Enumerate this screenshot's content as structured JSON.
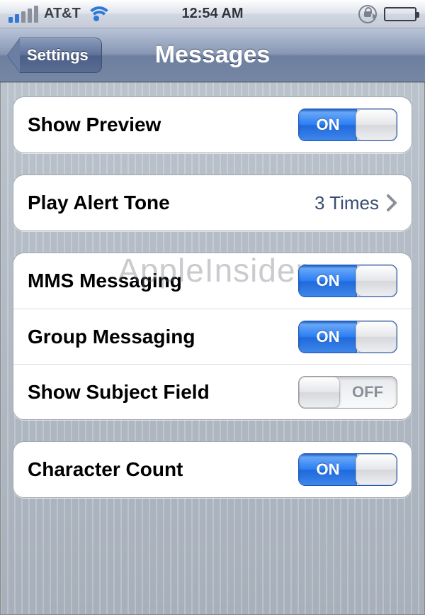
{
  "status": {
    "carrier": "AT&T",
    "signal_bars_active": 2,
    "time": "12:54 AM"
  },
  "nav": {
    "back_label": "Settings",
    "title": "Messages"
  },
  "toggle_labels": {
    "on": "ON",
    "off": "OFF"
  },
  "groups": {
    "preview": {
      "show_preview": {
        "label": "Show Preview",
        "state": "on"
      }
    },
    "alert": {
      "play_alert_tone": {
        "label": "Play Alert Tone",
        "value": "3 Times"
      }
    },
    "messaging": {
      "mms": {
        "label": "MMS Messaging",
        "state": "on"
      },
      "group": {
        "label": "Group Messaging",
        "state": "on"
      },
      "subject": {
        "label": "Show Subject Field",
        "state": "off"
      }
    },
    "char": {
      "count": {
        "label": "Character Count",
        "state": "on"
      }
    }
  },
  "watermark": "AppleInsider"
}
